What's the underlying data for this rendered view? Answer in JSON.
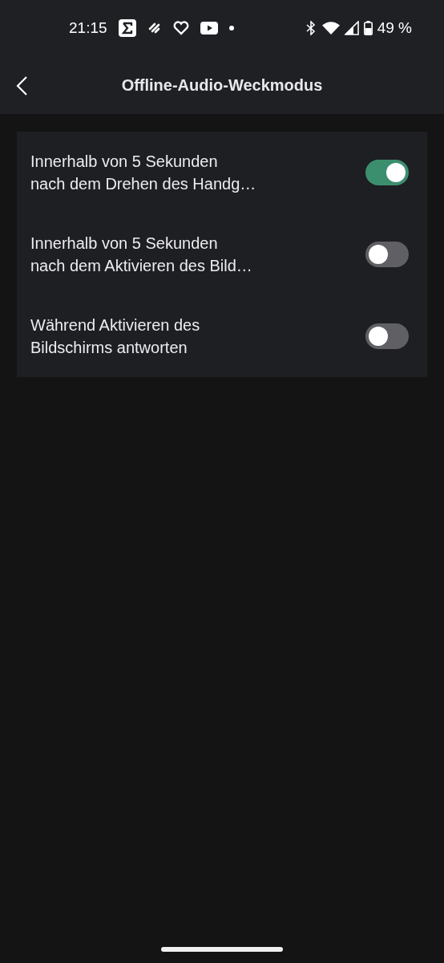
{
  "status_bar": {
    "time": "21:15",
    "battery": "49 %"
  },
  "header": {
    "title": "Offline-Audio-Weckmodus"
  },
  "settings": [
    {
      "label": "Innerhalb von 5 Sekunden\nnach dem Drehen des Handg…",
      "on": true
    },
    {
      "label": "Innerhalb von 5 Sekunden\nnach dem Aktivieren des Bild…",
      "on": false
    },
    {
      "label": "Während Aktivieren des\nBildschirms antworten",
      "on": false
    }
  ]
}
